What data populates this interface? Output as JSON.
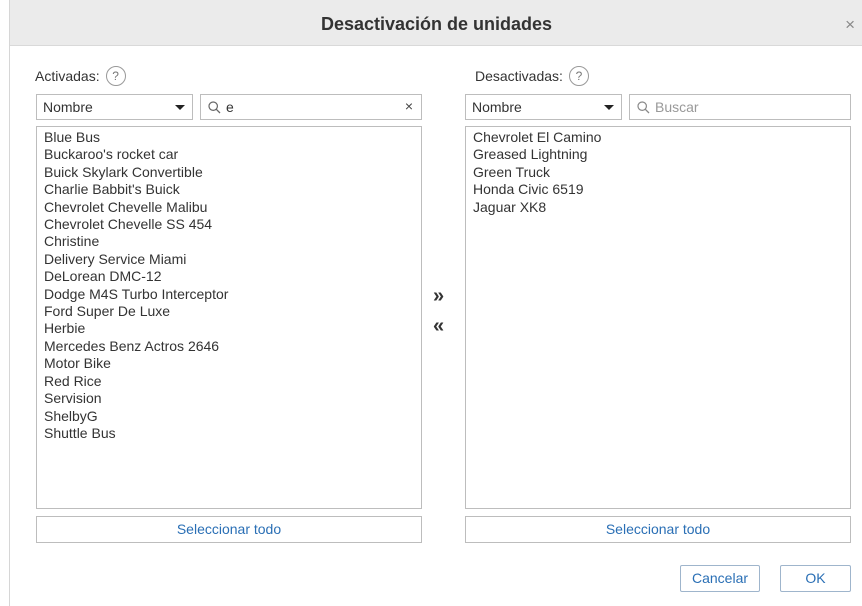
{
  "dialog": {
    "title": "Desactivación de unidades",
    "close_glyph": "×"
  },
  "left": {
    "label": "Activadas:",
    "help_glyph": "?",
    "sort_value": "Nombre",
    "search_value": "e",
    "clear_glyph": "×",
    "items": [
      "Blue Bus",
      "Buckaroo's rocket car",
      "Buick Skylark Convertible",
      "Charlie Babbit's Buick",
      "Chevrolet Chevelle Malibu",
      "Chevrolet Chevelle SS 454",
      "Christine",
      "Delivery Service Miami",
      "DeLorean DMC-12",
      "Dodge M4S Turbo Interceptor",
      "Ford Super De Luxe",
      "Herbie",
      "Mercedes Benz Actros 2646",
      "Motor Bike",
      "Red Rice",
      "Servision",
      "ShelbyG",
      "Shuttle Bus"
    ],
    "select_all_label": "Seleccionar todo"
  },
  "right": {
    "label": "Desactivadas:",
    "help_glyph": "?",
    "sort_value": "Nombre",
    "search_placeholder": "Buscar",
    "items": [
      "Chevrolet El Camino",
      "Greased Lightning",
      "Green Truck",
      "Honda Civic 6519",
      "Jaguar XK8"
    ],
    "select_all_label": "Seleccionar todo"
  },
  "transfer": {
    "move_right_glyph": "»",
    "move_left_glyph": "«"
  },
  "footer": {
    "cancel_label": "Cancelar",
    "ok_label": "OK"
  }
}
